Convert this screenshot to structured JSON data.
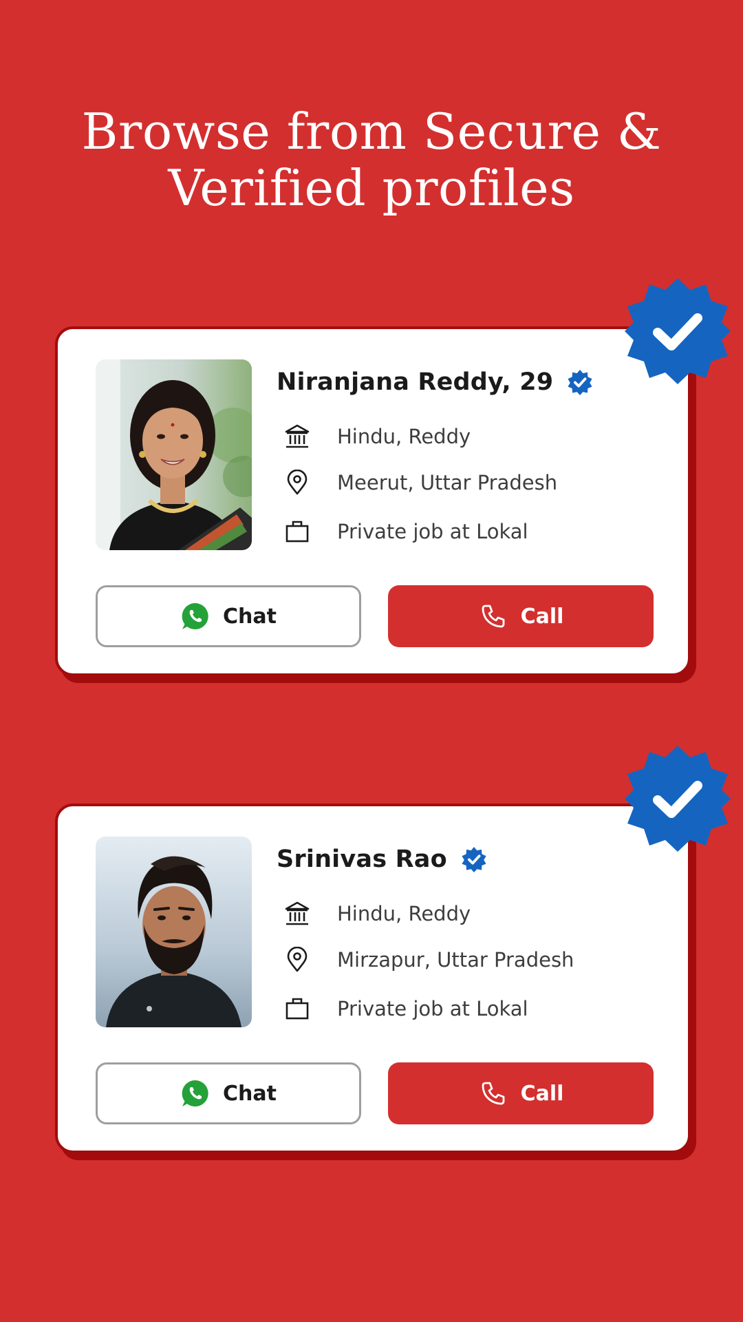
{
  "headline": {
    "line1": "Browse from Secure &",
    "line2": "Verified profiles"
  },
  "colors": {
    "background": "#d32f2f",
    "card_shadow": "#a30c0c",
    "verified_blue": "#1565c0",
    "whatsapp_green": "#25a13a"
  },
  "profiles": [
    {
      "name": "Niranjana Reddy, 29",
      "photo": "woman-portrait",
      "religion": "Hindu, Reddy",
      "location": "Meerut, Uttar Pradesh",
      "job": "Private job at Lokal",
      "chat_label": "Chat",
      "call_label": "Call"
    },
    {
      "name": "Srinivas Rao",
      "photo": "man-portrait",
      "religion": "Hindu, Reddy",
      "location": "Mirzapur, Uttar Pradesh",
      "job": "Private job at Lokal",
      "chat_label": "Chat",
      "call_label": "Call"
    }
  ],
  "icons": {
    "religion": "temple-icon",
    "location": "location-pin-icon",
    "job": "briefcase-icon",
    "chat": "whatsapp-icon",
    "call": "phone-icon",
    "verified": "verified-badge-icon"
  }
}
